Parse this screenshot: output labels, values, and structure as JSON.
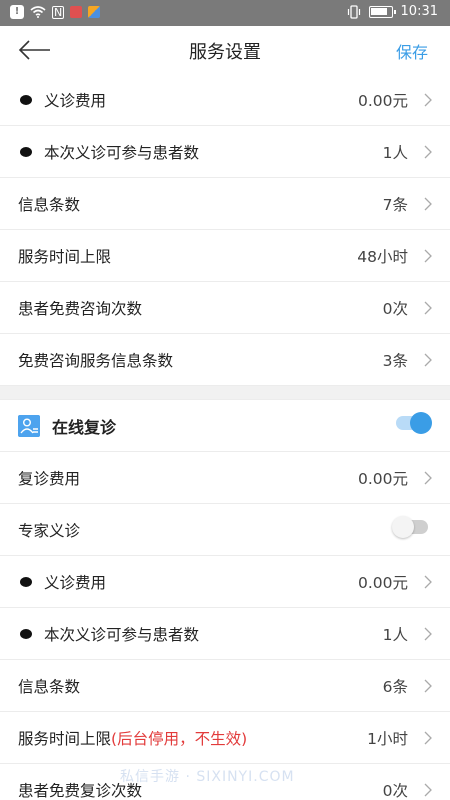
{
  "status_bar": {
    "badge": "!",
    "nfc": "N",
    "time": "10:31"
  },
  "header": {
    "title": "服务设置",
    "save_label": "保存"
  },
  "group1": [
    {
      "label": "义诊费用",
      "value": "0.00元"
    },
    {
      "label": "本次义诊可参与患者数",
      "value": "1人"
    },
    {
      "label": "信息条数",
      "value": "7条"
    },
    {
      "label": "服务时间上限",
      "value": "48小时"
    },
    {
      "label": "患者免费咨询次数",
      "value": "0次"
    },
    {
      "label": "免费咨询服务信息条数",
      "value": "3条"
    }
  ],
  "online_revisit": {
    "title": "在线复诊",
    "enabled": true
  },
  "group2": {
    "revisit_fee": {
      "label": "复诊费用",
      "value": "0.00元"
    },
    "expert": {
      "label": "专家义诊",
      "enabled": false
    },
    "fee": {
      "label": "义诊费用",
      "value": "0.00元"
    },
    "patients": {
      "label": "本次义诊可参与患者数",
      "value": "1人"
    },
    "messages": {
      "label": "信息条数",
      "value": "6条"
    },
    "time_limit": {
      "label": "服务时间上限",
      "note": "(后台停用，不生效)",
      "value": "1小时"
    },
    "free_revisit": {
      "label": "患者免费复诊次数",
      "value": "0次"
    }
  },
  "watermark": "私信手游 · SIXINYI.COM",
  "colors": {
    "accent": "#3a9de6",
    "warning": "#e23b3b",
    "status_bar": "#7a7a7a"
  }
}
